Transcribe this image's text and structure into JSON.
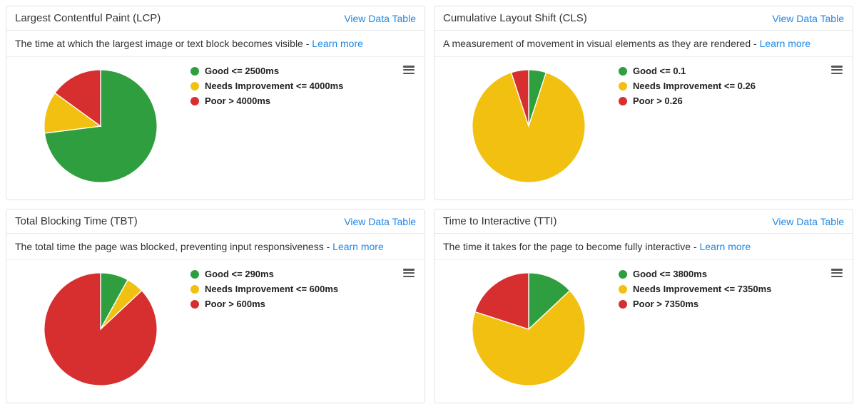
{
  "common": {
    "view_table": "View Data Table",
    "learn_more": "Learn more",
    "colors": {
      "good": "#2e9e3f",
      "needs": "#f2c010",
      "poor": "#d72f2f"
    }
  },
  "cards": [
    {
      "id": "lcp",
      "title": "Largest Contentful Paint (LCP)",
      "desc": "The time at which the largest image or text block becomes visible - ",
      "legend": [
        "Good <= 2500ms",
        "Needs Improvement <= 4000ms",
        "Poor > 4000ms"
      ]
    },
    {
      "id": "cls",
      "title": "Cumulative Layout Shift (CLS)",
      "desc": "A measurement of movement in visual elements as they are rendered - ",
      "legend": [
        "Good <= 0.1",
        "Needs Improvement <= 0.26",
        "Poor > 0.26"
      ]
    },
    {
      "id": "tbt",
      "title": "Total Blocking Time (TBT)",
      "desc": "The total time the page was blocked, preventing input responsiveness - ",
      "legend": [
        "Good <= 290ms",
        "Needs Improvement <= 600ms",
        "Poor > 600ms"
      ]
    },
    {
      "id": "tti",
      "title": "Time to Interactive (TTI)",
      "desc": "The time it takes for the page to become fully interactive - ",
      "legend": [
        "Good <= 3800ms",
        "Needs Improvement <= 7350ms",
        "Poor > 7350ms"
      ]
    }
  ],
  "chart_data": [
    {
      "type": "pie",
      "title": "Largest Contentful Paint (LCP)",
      "categories": [
        "Good <= 2500ms",
        "Needs Improvement <= 4000ms",
        "Poor > 4000ms"
      ],
      "values": [
        73,
        12,
        15
      ],
      "colors": [
        "#2e9e3f",
        "#f2c010",
        "#d72f2f"
      ]
    },
    {
      "type": "pie",
      "title": "Cumulative Layout Shift (CLS)",
      "categories": [
        "Good <= 0.1",
        "Needs Improvement <= 0.26",
        "Poor > 0.26"
      ],
      "values": [
        5,
        90,
        5
      ],
      "colors": [
        "#2e9e3f",
        "#f2c010",
        "#d72f2f"
      ]
    },
    {
      "type": "pie",
      "title": "Total Blocking Time (TBT)",
      "categories": [
        "Good <= 290ms",
        "Needs Improvement <= 600ms",
        "Poor > 600ms"
      ],
      "values": [
        8,
        5,
        87
      ],
      "colors": [
        "#2e9e3f",
        "#f2c010",
        "#d72f2f"
      ]
    },
    {
      "type": "pie",
      "title": "Time to Interactive (TTI)",
      "categories": [
        "Good <= 3800ms",
        "Needs Improvement <= 7350ms",
        "Poor > 7350ms"
      ],
      "values": [
        13,
        67,
        20
      ],
      "colors": [
        "#2e9e3f",
        "#f2c010",
        "#d72f2f"
      ]
    }
  ]
}
